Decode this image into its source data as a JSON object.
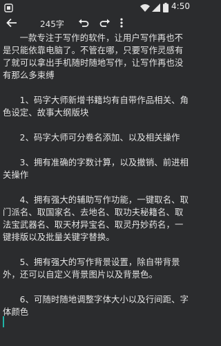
{
  "status_bar": {
    "time": "4:50",
    "icons": [
      "notification-icon",
      "wifi-icon",
      "signal-icon",
      "battery-icon"
    ]
  },
  "toolbar": {
    "back_icon": "arrow-left-icon",
    "word_count": "245字",
    "undo_icon": "undo-icon",
    "redo_icon": "redo-icon",
    "menu_icon": "more-vert-icon"
  },
  "editor": {
    "paragraphs": [
      "一款专注于写作的软件，让用户写作再也不是只能依靠电脑了。不管在哪，只要写作灵感有了就可以拿出手机随时随地写作，让写作再也没有那么多束缚",
      "1、码字大师新增书籍均有自带作品相关、角色设定、故事大纲版块",
      "2、码字大师可分卷名添加、以及相关操作",
      "3、拥有准确的字数计算，以及撤销、前进相关操作",
      "4、拥有强大的辅助写作功能，一键取名、取门派名、取国家名、去地名、取功夫秘籍名、取法宝武器名、取天材异宝名、取灵丹妙药名，一键排版以及批量关键字替换。",
      "5、拥有强大的写作背景设置，除自带背景外，还可以自定义背景图片以及背景色。",
      "6、可随时随地调整字体大小以及行间距、字体颜色"
    ]
  }
}
